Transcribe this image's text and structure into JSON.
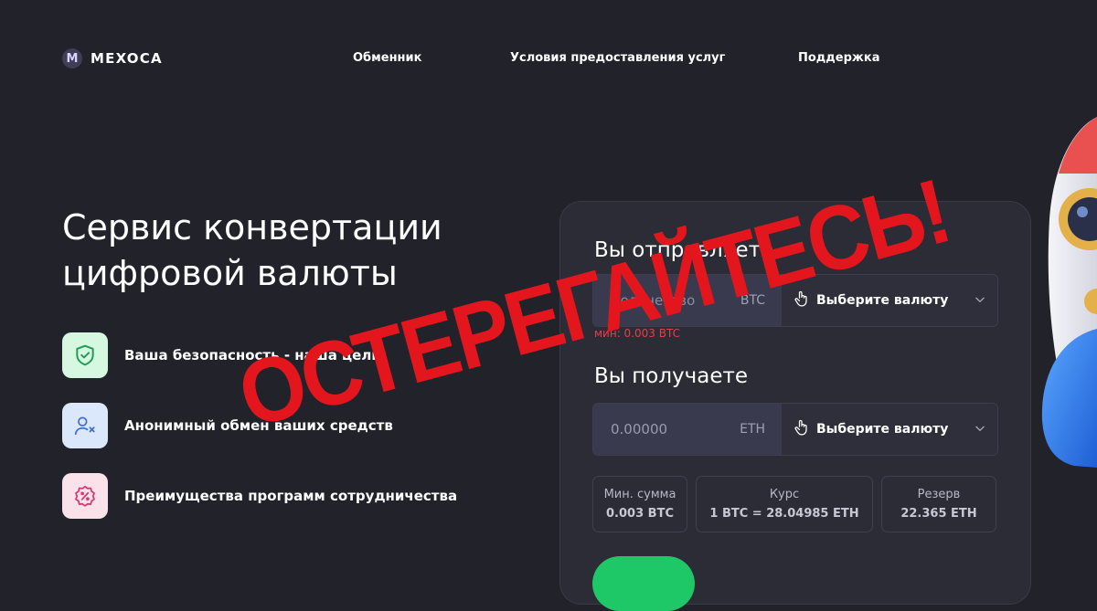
{
  "header": {
    "logo_badge": "M",
    "logo_text": "MEXOCA",
    "nav": [
      "Обменник",
      "Условия предоставления услуг",
      "Поддержка"
    ]
  },
  "hero": {
    "title": "Сервис конвертации цифровой валюты",
    "features": [
      {
        "label": "Ваша безопасность - наша цель",
        "icon": "shield-check-icon",
        "color": "#d6f7e0"
      },
      {
        "label": "Анонимный обмен ваших средств",
        "icon": "user-x-icon",
        "color": "#dbe8fb"
      },
      {
        "label": "Преимущества программ сотрудничества",
        "icon": "percent-badge-icon",
        "color": "#fbe1ea"
      }
    ]
  },
  "exchange": {
    "send_title": "Вы отправляете",
    "send_placeholder": "Количество",
    "send_currency": "BTC",
    "send_select": "Выберите валюту",
    "min_note": "мин: 0.003 BTC",
    "receive_title": "Вы получаете",
    "receive_value": "0.00000",
    "receive_currency": "ETH",
    "receive_select": "Выберите валюту",
    "stats": [
      {
        "label": "Мин. сумма",
        "value": "0.003 BTC"
      },
      {
        "label": "Курс",
        "value": "1 BTC = 28.04985 ETH"
      },
      {
        "label": "Резерв",
        "value": "22.365 ETH"
      }
    ],
    "accent_color": "#1ec866"
  },
  "overlay": {
    "stamp_text": "ОСТЕРЕГАЙТЕСЬ!",
    "color": "#e4161d"
  }
}
